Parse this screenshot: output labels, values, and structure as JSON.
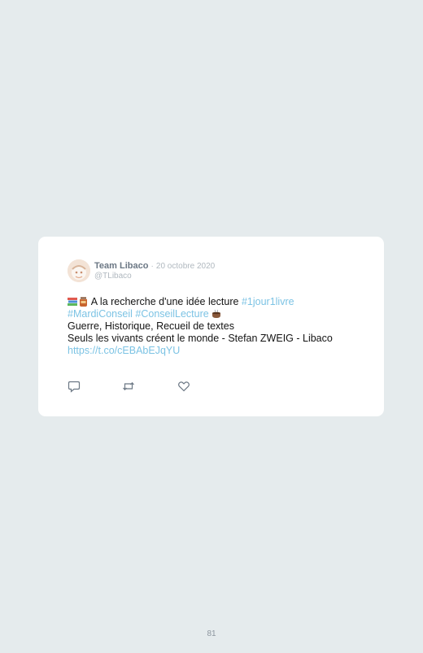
{
  "tweet": {
    "author_name": "Team Libaco",
    "separator": "·",
    "date": "20 octobre 2020",
    "handle": "@TLibaco",
    "line1_text": "A la recherche d'une idée lecture",
    "hashtag_1jour1livre": "#1jour1livre",
    "hashtag_mardiconseil": "#MardiConseil",
    "hashtag_conseillecture": "#ConseilLecture",
    "line3": "Guerre, Historique, Recueil de textes",
    "line4": "Seuls les vivants créent le monde - Stefan ZWEIG - Libaco",
    "link": "https://t.co/cEBAbEJqYU",
    "emojis": [
      "books-emoji",
      "jar-emoji",
      "coffee-emoji"
    ]
  },
  "actions": {
    "icons": [
      "reply-icon",
      "retweet-icon",
      "like-icon"
    ]
  },
  "page": {
    "number": "81"
  },
  "colors": {
    "background": "#e5ebed",
    "card": "#ffffff",
    "hashtag": "#7cc3e4",
    "muted": "#b0b8bf",
    "author": "#6b7784"
  }
}
